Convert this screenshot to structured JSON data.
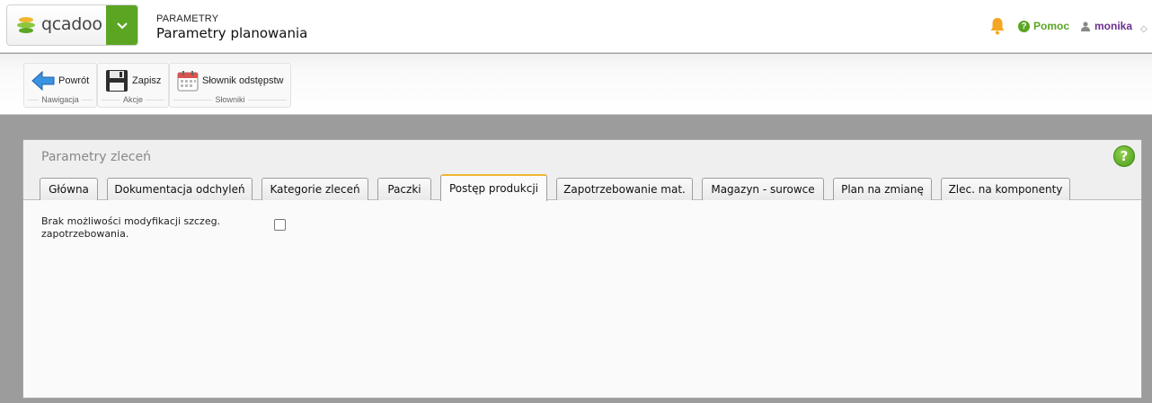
{
  "header": {
    "logo_text": "qcadoo",
    "breadcrumb_section": "PARAMETRY",
    "page_title": "Parametry planowania",
    "help_label": "Pomoc",
    "user_name": "monika",
    "icons": [
      "logo-icon",
      "chevron-down-icon",
      "bell-icon",
      "help-icon",
      "user-icon"
    ]
  },
  "ribbon": {
    "groups": [
      {
        "label": "Nawigacja",
        "buttons": [
          {
            "label": "Powrót",
            "icon": "back-arrow-icon"
          }
        ]
      },
      {
        "label": "Akcje",
        "buttons": [
          {
            "label": "Zapisz",
            "icon": "save-icon"
          }
        ]
      },
      {
        "label": "Słowniki",
        "buttons": [
          {
            "label": "Słownik odstępstw",
            "icon": "calendar-icon"
          }
        ]
      }
    ]
  },
  "panel": {
    "title": "Parametry zleceń",
    "tabs": [
      "Główna",
      "Dokumentacja odchyleń",
      "Kategorie zleceń",
      "Paczki",
      "Postęp produkcji",
      "Zapotrzebowanie mat.",
      "Magazyn - surowce",
      "Plan na zmianę",
      "Zlec. na komponenty"
    ],
    "active_tab": "Postęp produkcji",
    "field": {
      "label": "Brak możliwości modyfikacji szczeg. zapotrzebowania.",
      "checked": false
    }
  },
  "colors": {
    "brand_green": "#5ba523",
    "active_tab_accent": "#f0b630",
    "bell": "#f5a623",
    "user": "#6a2d8f",
    "background": "#9c9c9c"
  }
}
